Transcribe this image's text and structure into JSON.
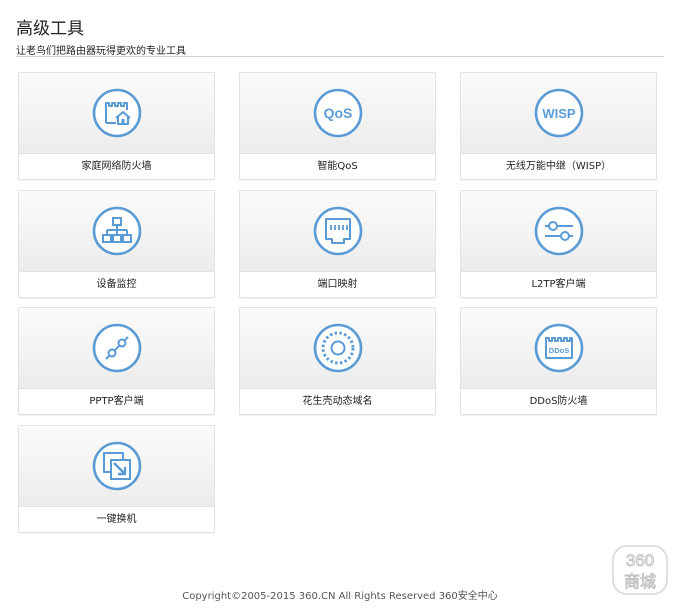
{
  "page": {
    "title": "高级工具",
    "subtitle": "让老鸟们把路由器玩得更欢的专业工具"
  },
  "accent_color": "#5b9bd5",
  "tools": [
    {
      "label": "家庭网络防火墙",
      "icon": "home-firewall-icon"
    },
    {
      "label": "智能QoS",
      "icon": "qos-icon",
      "icon_text": "QoS"
    },
    {
      "label": "无线万能中继（WISP）",
      "icon": "wisp-icon",
      "icon_text": "WISP"
    },
    {
      "label": "设备监控",
      "icon": "device-monitor-icon"
    },
    {
      "label": "端口映射",
      "icon": "port-mapping-icon"
    },
    {
      "label": "L2TP客户端",
      "icon": "l2tp-sliders-icon"
    },
    {
      "label": "PPTP客户端",
      "icon": "pptp-link-icon"
    },
    {
      "label": "花生壳动态域名",
      "icon": "ddns-ring-icon"
    },
    {
      "label": "DDoS防火墙",
      "icon": "ddos-firewall-icon",
      "icon_text": "DDoS"
    },
    {
      "label": "一键换机",
      "icon": "one-click-switch-icon"
    }
  ],
  "footer": {
    "copyright": "Copyright©2005-2015 360.CN All Rights Reserved 360安全中心"
  },
  "watermark": {
    "line1": "360",
    "line2": "商城"
  }
}
